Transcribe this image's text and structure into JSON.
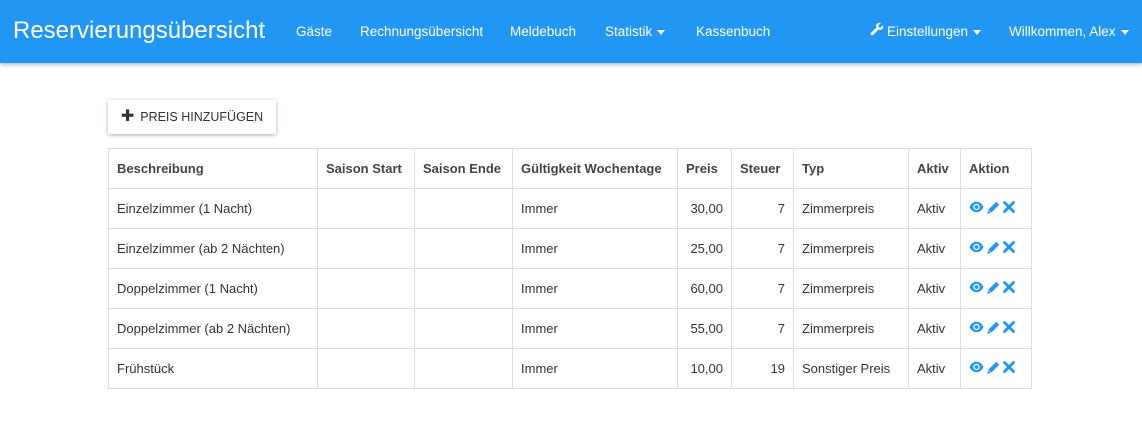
{
  "navbar": {
    "brand": "Reservierungsübersicht",
    "items": [
      {
        "label": "Gäste"
      },
      {
        "label": "Rechnungsübersicht"
      },
      {
        "label": "Meldebuch"
      },
      {
        "label": "Statistik"
      },
      {
        "label": "Kassenbuch"
      }
    ],
    "settings_label": "Einstellungen",
    "user_label": "Willkommen, Alex",
    "color": "#2196f3"
  },
  "toolbar": {
    "add_price_label": "PREIS HINZUFÜGEN"
  },
  "table": {
    "columns": [
      "Beschreibung",
      "Saison Start",
      "Saison Ende",
      "Gültigkeit Wochentage",
      "Preis",
      "Steuer",
      "Typ",
      "Aktiv",
      "Aktion"
    ],
    "rows": [
      {
        "beschreibung": "Einzelzimmer (1 Nacht)",
        "saison_start": "",
        "saison_ende": "",
        "gueltigkeit": "Immer",
        "preis": "30,00",
        "steuer": "7",
        "typ": "Zimmerpreis",
        "aktiv": "Aktiv"
      },
      {
        "beschreibung": "Einzelzimmer (ab 2 Nächten)",
        "saison_start": "",
        "saison_ende": "",
        "gueltigkeit": "Immer",
        "preis": "25,00",
        "steuer": "7",
        "typ": "Zimmerpreis",
        "aktiv": "Aktiv"
      },
      {
        "beschreibung": "Doppelzimmer (1 Nacht)",
        "saison_start": "",
        "saison_ende": "",
        "gueltigkeit": "Immer",
        "preis": "60,00",
        "steuer": "7",
        "typ": "Zimmerpreis",
        "aktiv": "Aktiv"
      },
      {
        "beschreibung": "Doppelzimmer (ab 2 Nächten)",
        "saison_start": "",
        "saison_ende": "",
        "gueltigkeit": "Immer",
        "preis": "55,00",
        "steuer": "7",
        "typ": "Zimmerpreis",
        "aktiv": "Aktiv"
      },
      {
        "beschreibung": "Frühstück",
        "saison_start": "",
        "saison_ende": "",
        "gueltigkeit": "Immer",
        "preis": "10,00",
        "steuer": "19",
        "typ": "Sonstiger Preis",
        "aktiv": "Aktiv"
      }
    ],
    "action_icons": [
      "eye-icon",
      "pencil-icon",
      "close-icon"
    ],
    "action_color": "#2196f3"
  }
}
